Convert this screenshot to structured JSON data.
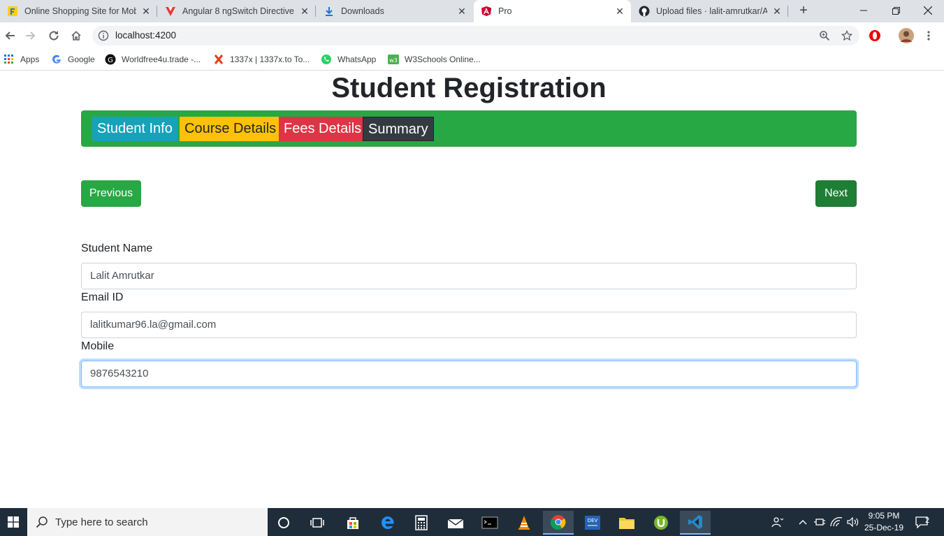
{
  "browser": {
    "tabs": [
      {
        "title": "Online Shopping Site for Mob",
        "icon": "flipkart-icon"
      },
      {
        "title": "Angular 8 ngSwitch Directive -",
        "icon": "vue-icon"
      },
      {
        "title": "Downloads",
        "icon": "download-icon"
      },
      {
        "title": "Pro",
        "icon": "angular-icon",
        "active": true
      },
      {
        "title": "Upload files · lalit-amrutkar/Ar",
        "icon": "github-icon"
      }
    ],
    "url": "localhost:4200",
    "bookmarks": [
      {
        "label": "Apps",
        "icon": "apps-icon"
      },
      {
        "label": "Google",
        "icon": "google-icon"
      },
      {
        "label": "Worldfree4u.trade -...",
        "icon": "worldfree-icon"
      },
      {
        "label": "1337x | 1337x.to To...",
        "icon": "x-icon"
      },
      {
        "label": "WhatsApp",
        "icon": "whatsapp-icon"
      },
      {
        "label": "W3Schools Online...",
        "icon": "w3schools-icon"
      }
    ]
  },
  "page": {
    "title": "Student Registration",
    "steps": [
      "Student Info",
      "Course Details",
      "Fees Details",
      "Summary"
    ],
    "previous_label": "Previous",
    "next_label": "Next",
    "fields": [
      {
        "label": "Student Name",
        "value": "Lalit Amrutkar"
      },
      {
        "label": "Email ID",
        "value": "lalitkumar96.la@gmail.com"
      },
      {
        "label": "Mobile",
        "value": "9876543210"
      }
    ]
  },
  "taskbar": {
    "search_placeholder": "Type here to search",
    "time": "9:05 PM",
    "date": "25-Dec-19",
    "notification_count": "2"
  },
  "colors": {
    "step_bar": "#28a745",
    "student_info": "#17a2b8",
    "course_details": "#ffc107",
    "fees_details": "#dc3545",
    "summary": "#343a40"
  }
}
